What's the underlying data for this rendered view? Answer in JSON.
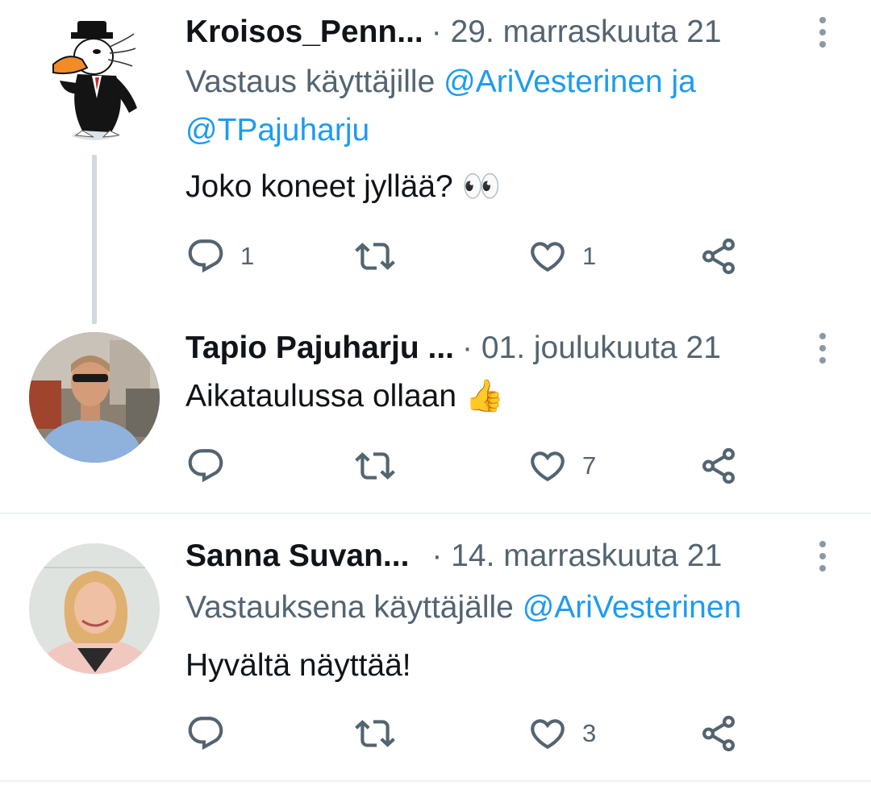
{
  "tweets": [
    {
      "author": "Kroisos_Penn...",
      "date": "· 29. marraskuuta 21",
      "reply_prefix": "Vastaus käyttäjille",
      "reply_mention_1": "@AriVesterinen",
      "reply_joiner": "ja",
      "reply_mention_2": "@TPajuharju",
      "text": "Joko koneet jyllää?",
      "emoji": "👀",
      "replies": "1",
      "retweets": "",
      "likes": "1"
    },
    {
      "author": "Tapio Pajuharju ...",
      "date": "· 01. joulukuuta 21",
      "text": "Aikataulussa ollaan",
      "emoji": "👍",
      "replies": "",
      "retweets": "",
      "likes": "7"
    },
    {
      "author": "Sanna Suvan...",
      "date": "· 14. marraskuuta 21",
      "reply_prefix": "Vastauksena käyttäjälle",
      "reply_mention_1": "@AriVesterinen",
      "text": "Hyvältä näyttää!",
      "replies": "",
      "retweets": "",
      "likes": "3"
    }
  ],
  "icons": {
    "reply": "reply-icon",
    "retweet": "retweet-icon",
    "like": "heart-icon",
    "share": "share-icon",
    "more": "more-vertical-icon"
  },
  "colors": {
    "text": "#0f1419",
    "secondary": "#536471",
    "link": "#1d9bf0",
    "icon": "#536471",
    "divider": "#eff3f4"
  }
}
